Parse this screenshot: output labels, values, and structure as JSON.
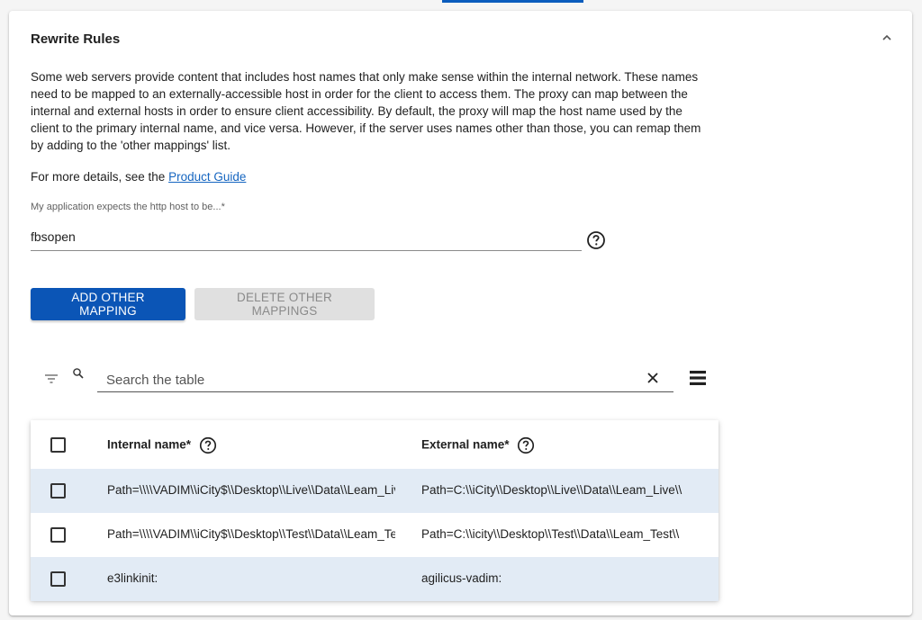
{
  "panel": {
    "title": "Rewrite Rules",
    "description": "Some web servers provide content that includes host names that only make sense within the internal network. These names need to be mapped to an externally-accessible host in order for the client to access them. The proxy can map between the internal and external hosts in order to ensure client accessibility. By default, the proxy will map the host name used by the client to the primary internal name, and vice versa. However, if the server uses names other than those, you can remap them by adding to the 'other mappings' list.",
    "details_prefix": "For more details, see the ",
    "details_link": "Product Guide"
  },
  "host_field": {
    "label": "My application expects the http host to be...*",
    "value": "fbsopen"
  },
  "buttons": {
    "add": "ADD OTHER MAPPING",
    "delete": "DELETE OTHER MAPPINGS"
  },
  "search": {
    "placeholder": "Search the table"
  },
  "table": {
    "columns": [
      "Internal name*",
      "External name*"
    ],
    "rows": [
      {
        "internal": "Path=\\\\\\\\VADIM\\\\iCity$\\\\Desktop\\\\Live\\\\Data\\\\Leam_Live\\\\",
        "external": "Path=C:\\\\iCity\\\\Desktop\\\\Live\\\\Data\\\\Leam_Live\\\\"
      },
      {
        "internal": "Path=\\\\\\\\VADIM\\\\iCity$\\\\Desktop\\\\Test\\\\Data\\\\Leam_Test\\\\",
        "external": "Path=C:\\\\icity\\\\Desktop\\\\Test\\\\Data\\\\Leam_Test\\\\"
      },
      {
        "internal": "e3linkinit:",
        "external": "agilicus-vadim:"
      }
    ]
  },
  "colors": {
    "primary": "#0b55b6",
    "link": "#1565c0",
    "row_highlight": "#e2ebf5"
  },
  "icons": [
    "chevron-up-icon",
    "help-icon",
    "filter-icon",
    "search-icon",
    "clear-icon",
    "menu-icon"
  ]
}
